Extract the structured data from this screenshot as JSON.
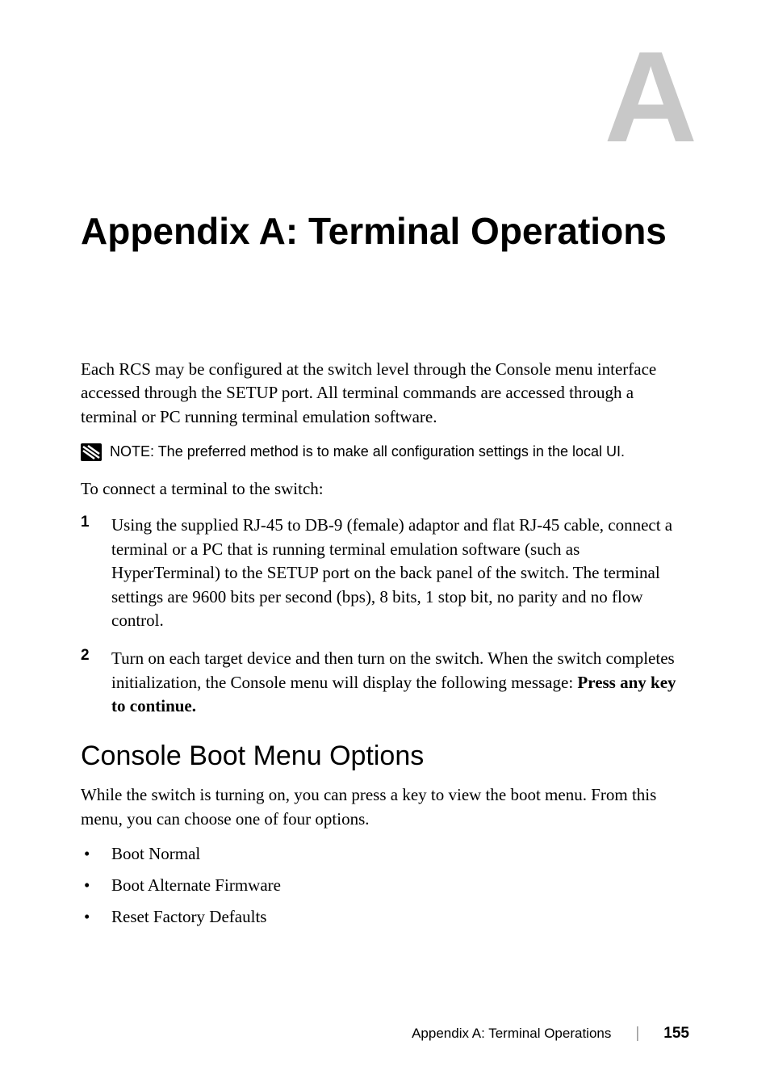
{
  "appendix_letter": "A",
  "title": "Appendix A: Terminal Operations",
  "intro": "Each RCS may be configured at the switch level through the Console menu interface accessed through the SETUP port. All terminal commands are accessed through a terminal or PC running terminal emulation software.",
  "note": {
    "label": "NOTE: ",
    "text": "The preferred method is to make all configuration settings in the local UI."
  },
  "connect_intro": "To connect a terminal to the switch:",
  "steps": [
    {
      "marker": "1",
      "text": "Using the supplied RJ-45 to DB-9 (female) adaptor and flat RJ-45 cable, connect a terminal or a PC that is running terminal emulation software (such as HyperTerminal) to the SETUP port on the back panel of the switch. The terminal settings are 9600 bits per second (bps), 8 bits, 1 stop bit, no parity and no flow control."
    },
    {
      "marker": "2",
      "text_pre": "Turn on each target device and then turn on the switch. When the switch completes initialization, the Console menu will display the following message: ",
      "text_bold": "Press any key to continue."
    }
  ],
  "section": {
    "heading": "Console Boot Menu Options",
    "body": "While the switch is turning on, you can press a key to view the boot menu. From this menu, you can choose one of four options.",
    "bullets": [
      "Boot Normal",
      "Boot Alternate Firmware",
      "Reset Factory Defaults"
    ]
  },
  "footer": {
    "text": "Appendix A: Terminal Operations",
    "page": "155"
  }
}
